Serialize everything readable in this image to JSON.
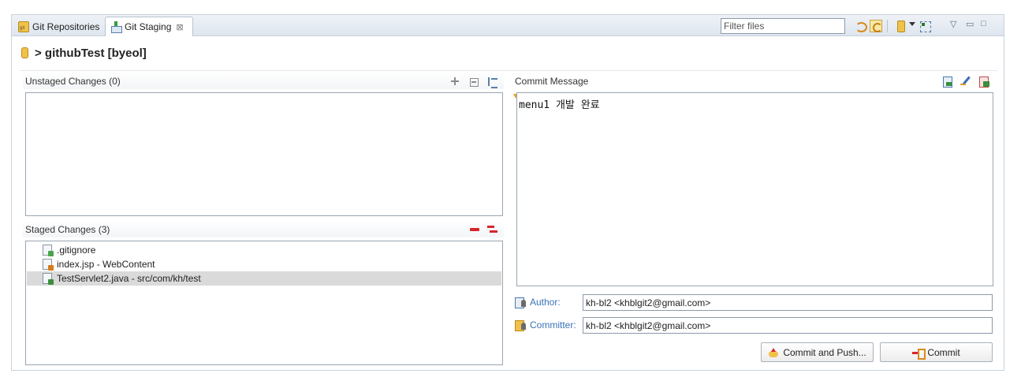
{
  "tabs": [
    {
      "label": "Git Repositories",
      "icon": "git-repositories-icon"
    },
    {
      "label": "Git Staging",
      "icon": "git-staging-icon",
      "close": "⊠",
      "active": true
    }
  ],
  "toolbar": {
    "filter_placeholder": "Filter files"
  },
  "header": {
    "repo_title": "> githubTest [byeol]"
  },
  "unstaged": {
    "title": "Unstaged Changes (0)",
    "items": []
  },
  "staged": {
    "title": "Staged Changes (3)",
    "items": [
      {
        "label": ".gitignore",
        "type": "text"
      },
      {
        "label": "index.jsp - WebContent",
        "type": "jsp"
      },
      {
        "label": "TestServlet2.java - src/com/kh/test",
        "type": "java",
        "selected": true
      }
    ]
  },
  "commit": {
    "title": "Commit Message",
    "message": "menu1 개발 완료",
    "author_label": "Author:",
    "author_value": "kh-bl2 <khblgit2@gmail.com>",
    "committer_label": "Committer:",
    "committer_value": "kh-bl2 <khblgit2@gmail.com>",
    "commit_push_label": "Commit and Push...",
    "commit_label": "Commit"
  },
  "colors": {
    "accent_link": "#3a72b8",
    "remove_red": "#d6262c",
    "selected_row": "#dadada"
  }
}
